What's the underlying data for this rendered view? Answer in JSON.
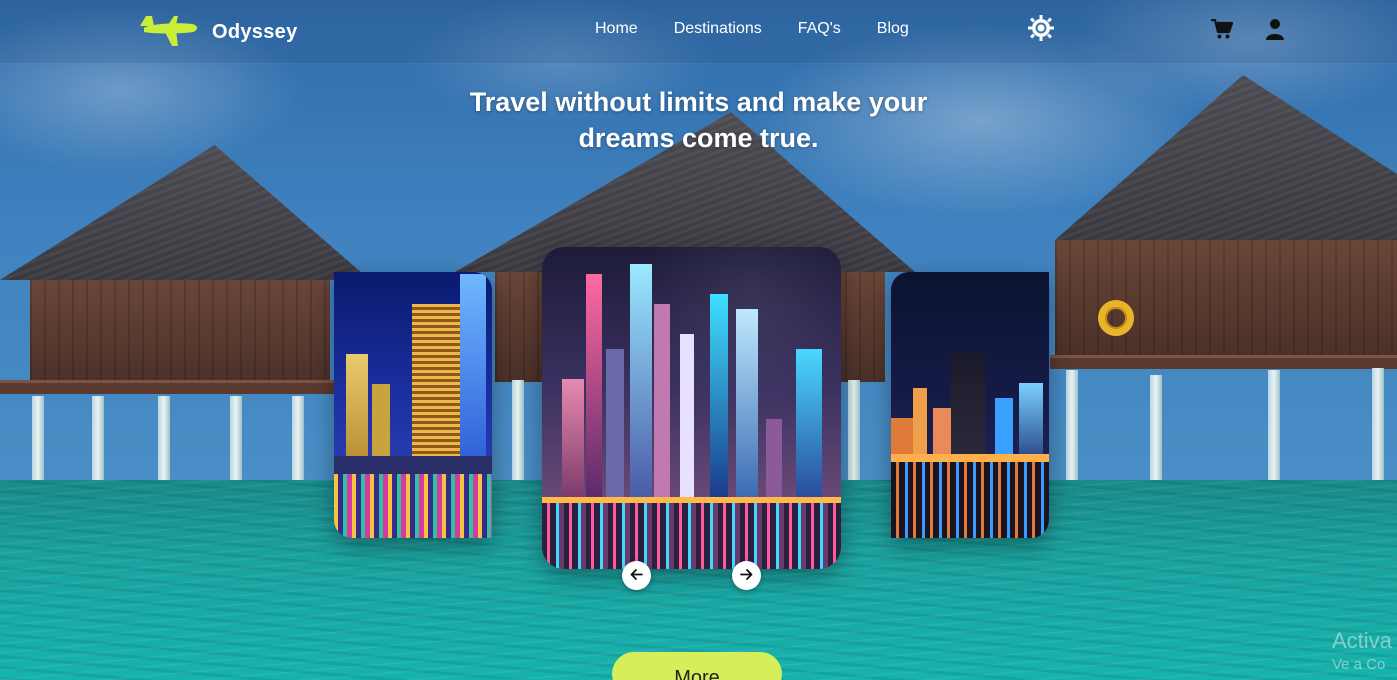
{
  "nav": {
    "brand": "Odyssey",
    "links": [
      "Home",
      "Destinations",
      "FAQ's",
      "Blog"
    ]
  },
  "icons": {
    "logo": "airplane-icon",
    "theme": "sun-icon",
    "cart": "cart-icon",
    "user": "user-icon",
    "prev": "arrow-left-icon",
    "next": "arrow-right-icon"
  },
  "colors": {
    "accent": "#d6ee5a",
    "logo": "#c9ee3a"
  },
  "hero": {
    "headline_line1": "Travel without limits and make your",
    "headline_line2": "dreams come true."
  },
  "carousel": {
    "slides": [
      "city-night-left",
      "city-night-center",
      "city-night-right"
    ],
    "active_index": 1
  },
  "cta": {
    "more_label": "More"
  },
  "watermark": {
    "line1": "Activa",
    "line2": "Ve a Co"
  }
}
